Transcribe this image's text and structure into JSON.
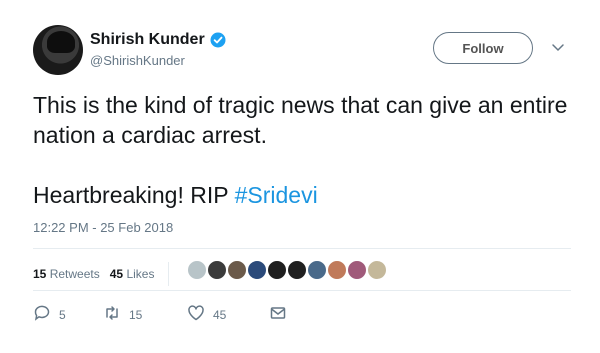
{
  "user": {
    "display_name": "Shirish Kunder",
    "handle": "@ShirishKunder",
    "verified_icon": "verified-badge-icon",
    "follow_label": "Follow"
  },
  "tweet": {
    "line1": "This is the kind of tragic news that can give an entire nation a cardiac arrest.",
    "line2_text": "Heartbreaking! RIP ",
    "hashtag": "#Sridevi",
    "timestamp": "12:22 PM - 25 Feb 2018"
  },
  "stats": {
    "retweets_count": "15",
    "retweets_label": "Retweets",
    "likes_count": "45",
    "likes_label": "Likes"
  },
  "likers": [
    "#b8c4c8",
    "#3b3b3b",
    "#6b5a4a",
    "#2b4a7a",
    "#1f1f1f",
    "#202020",
    "#4a6a8a",
    "#c07a5a",
    "#a05a7a",
    "#c4b89a"
  ],
  "actions": {
    "reply_count": "5",
    "retweet_count": "15",
    "like_count": "45"
  },
  "colors": {
    "accent": "#1b95e0",
    "text": "#14171a",
    "muted": "#657786"
  }
}
